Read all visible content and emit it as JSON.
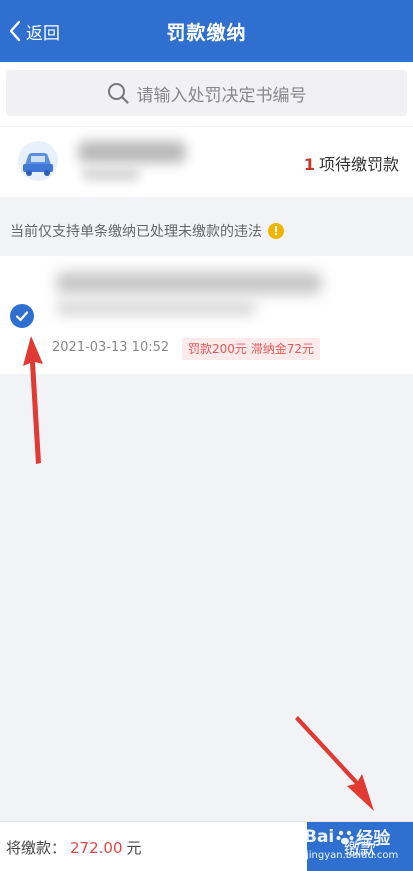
{
  "header": {
    "back_label": "返回",
    "title": "罚款缴纳"
  },
  "search": {
    "placeholder": "请输入处罚决定书编号"
  },
  "vehicle": {
    "pending_count": "1",
    "pending_text": "项待缴罚款"
  },
  "notice": {
    "text": "当前仅支持单条缴纳已处理未缴款的违法",
    "icon_glyph": "!"
  },
  "violation": {
    "datetime": "2021-03-13 10:52",
    "fine_tag": "罚款200元 滞纳金72元",
    "selected": true
  },
  "footer": {
    "total_label": "将缴款：",
    "total_amount": "272.00",
    "currency": "元",
    "pay_label": "缴款"
  },
  "watermark": {
    "brand": "Bai",
    "brand2": "经验",
    "sub": "jingyan.baidu.com"
  },
  "icons": {
    "back": "chevron-left-icon",
    "search": "search-icon",
    "car": "car-icon",
    "warning": "warning-icon",
    "check": "checkmark-icon",
    "paw": "paw-icon"
  },
  "colors": {
    "primary": "#2f6fd0",
    "fine_red": "#e35a5a",
    "warning": "#f1b400",
    "arrow": "#e03a32"
  }
}
